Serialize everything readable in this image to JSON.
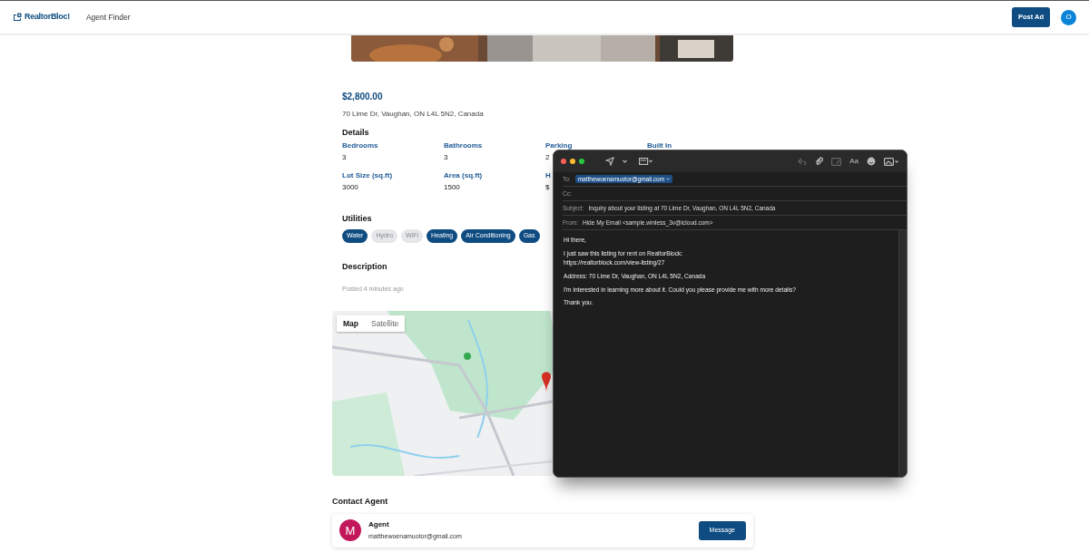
{
  "navbar": {
    "brand": "RealtorBloc!",
    "links": [
      "Agent Finder"
    ],
    "post_button": "Post Ad",
    "avatar_initial": "O"
  },
  "listing": {
    "price": "$2,800.00",
    "address": "70 Lime Dr, Vaughan, ON L4L 5N2, Canada",
    "details_heading": "Details",
    "details": [
      {
        "label": "Bedrooms",
        "value": "3"
      },
      {
        "label": "Bathrooms",
        "value": "3"
      },
      {
        "label": "Parking",
        "value": "2"
      },
      {
        "label": "Built In"
      },
      {
        "label": "Lot Size (sq.ft)",
        "value": "3000"
      },
      {
        "label": "Area (sq.ft)",
        "value": "1500"
      },
      {
        "label": "H",
        "value": "$"
      }
    ],
    "utilities_heading": "Utilities",
    "utilities": [
      {
        "label": "Water",
        "included": true
      },
      {
        "label": "Hydro",
        "included": false
      },
      {
        "label": "WiFi",
        "included": false
      },
      {
        "label": "Heating",
        "included": true
      },
      {
        "label": "Air Conditioning",
        "included": true
      },
      {
        "label": "Gas",
        "included": true
      }
    ],
    "description_heading": "Description",
    "posted": "Posted 4 minutes ago",
    "map": {
      "toggles": [
        {
          "label": "Map",
          "selected": true
        },
        {
          "label": "Satellite",
          "selected": false
        }
      ]
    },
    "contact_heading": "Contact Agent",
    "agent": {
      "initial": "M",
      "name": "Agent",
      "email": "matthewoenamuotor@gmail.com",
      "button": "Message"
    }
  },
  "mail": {
    "fields": [
      {
        "label": "To:",
        "value": "matthewoenamuotor@gmail.com",
        "kind": "chip"
      },
      {
        "label": "Cc:"
      },
      {
        "label": "Subject:",
        "value": "Inquiry about your listing at 70 Lime Dr, Vaughan, ON L4L 5N2, Canada",
        "kind": "text"
      },
      {
        "label": "From:",
        "value": "Hide My Email <sample.winless_3v@icloud.com>",
        "kind": "text"
      }
    ],
    "toolbar_text": "Aa",
    "body": [
      "Hi there,",
      "I just saw this listing for rent on RealtorBlock:\nhttps://realtorblock.com/view-listing/27",
      "Address: 70 Lime Dr, Vaughan, ON L4L 5N2, Canada",
      "I'm interested in learning more about it. Could you please provide me with more details?",
      "Thank you."
    ]
  }
}
